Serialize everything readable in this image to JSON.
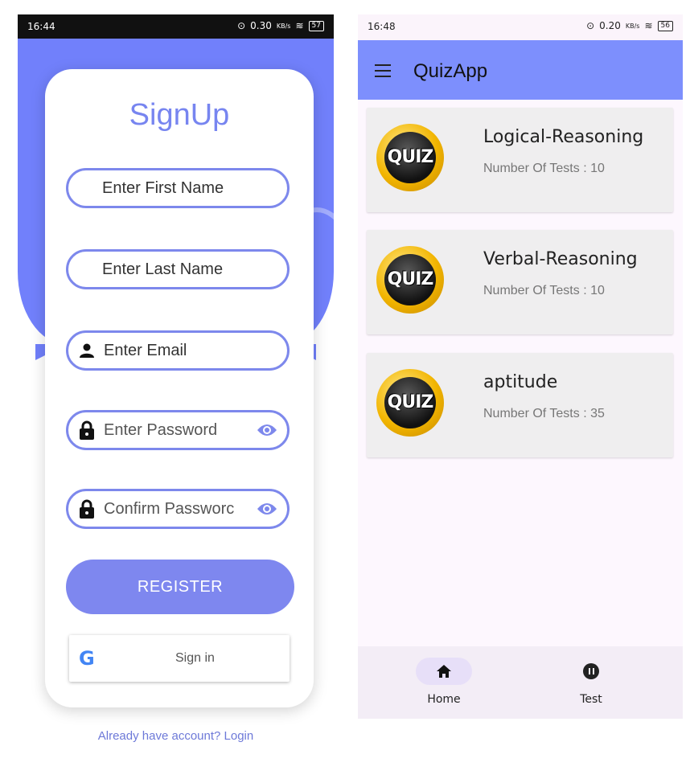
{
  "signup": {
    "status": {
      "time": "16:44",
      "net": "0.30",
      "net_unit": "KB/s",
      "battery": "57"
    },
    "title": "SignUp",
    "fields": {
      "first_name": "Enter First Name",
      "last_name": "Enter Last Name",
      "email": "Enter Email",
      "password": "Enter Password",
      "confirm": "Confirm Passworc"
    },
    "register_label": "REGISTER",
    "google_label": "Sign in",
    "login_link": "Already have account? Login"
  },
  "quiz": {
    "status": {
      "time": "16:48",
      "net": "0.20",
      "net_unit": "KB/s",
      "battery": "56"
    },
    "app_title": "QuizApp",
    "cards": [
      {
        "logo_text": "QUIZ",
        "name": "Logical-Reasoning",
        "count": "Number Of Tests : 10"
      },
      {
        "logo_text": "QUIZ",
        "name": "Verbal-Reasoning",
        "count": "Number Of Tests : 10"
      },
      {
        "logo_text": "QUIZ",
        "name": "aptitude",
        "count": "Number Of Tests : 35"
      }
    ],
    "nav": [
      {
        "label": "Home",
        "icon": "home-icon",
        "active": true
      },
      {
        "label": "Test",
        "icon": "pause-circle-icon",
        "active": false
      }
    ]
  },
  "colors": {
    "primary": "#7180fb",
    "appbar": "#7d8ffd",
    "button": "#7e87ef"
  }
}
